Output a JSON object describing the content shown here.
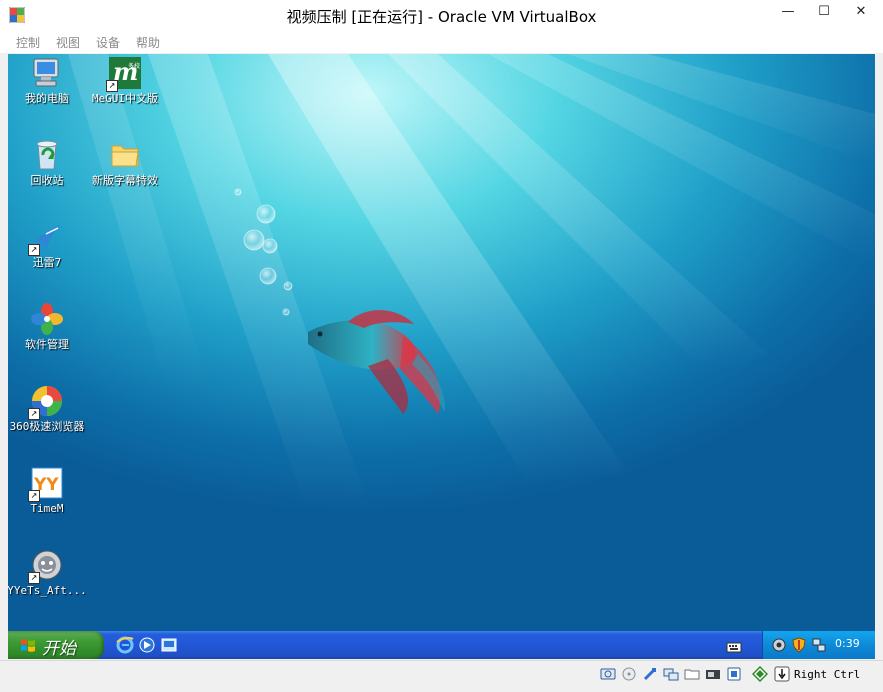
{
  "window": {
    "title": "视频压制 [正在运行] - Oracle VM VirtualBox",
    "minimize": "—",
    "maximize": "☐",
    "close": "✕"
  },
  "menu": [
    "控制",
    "视图",
    "设备",
    "帮助"
  ],
  "desktop": {
    "icons": [
      {
        "label": "我的电脑",
        "icon": "computer-icon"
      },
      {
        "label": "MeGUI中文版",
        "icon": "megui-icon"
      },
      {
        "label": "回收站",
        "icon": "recycle-bin-icon"
      },
      {
        "label": "新版字幕特效",
        "icon": "folder-icon"
      },
      {
        "label": "迅雷7",
        "icon": "thunder-icon"
      },
      {
        "label": "软件管理",
        "icon": "software-manager-icon"
      },
      {
        "label": "360极速浏览器",
        "icon": "360-browser-icon"
      },
      {
        "label": "TimeM",
        "icon": "timem-icon"
      },
      {
        "label": "YYeTs_Aft...",
        "icon": "yyets-icon"
      }
    ],
    "megui_badge": "m",
    "megui_sub": "多校",
    "timem_badge": "YY"
  },
  "taskbar": {
    "start_label": "开始",
    "clock": "0:39",
    "quicklaunch": [
      "ie-icon",
      "media-icon",
      "desktop-show-icon"
    ],
    "tray": [
      "keyboard-icon",
      "sound-icon",
      "shield-icon",
      "network-icon"
    ]
  },
  "statusbar": {
    "host_key": "Right Ctrl",
    "icons": [
      "hard-disk-icon",
      "optical-drive-icon",
      "usb-icon",
      "shared-folders-icon",
      "display-icon",
      "video-capture-icon",
      "network-adapter-icon",
      "guest-additions-icon",
      "mouse-integration-icon",
      "host-key-arrow-icon"
    ]
  },
  "colors": {
    "taskbar": "#245edb",
    "start": "#3c9a34",
    "tray": "#0e8ad8",
    "desktop": "#1f9fc8"
  }
}
